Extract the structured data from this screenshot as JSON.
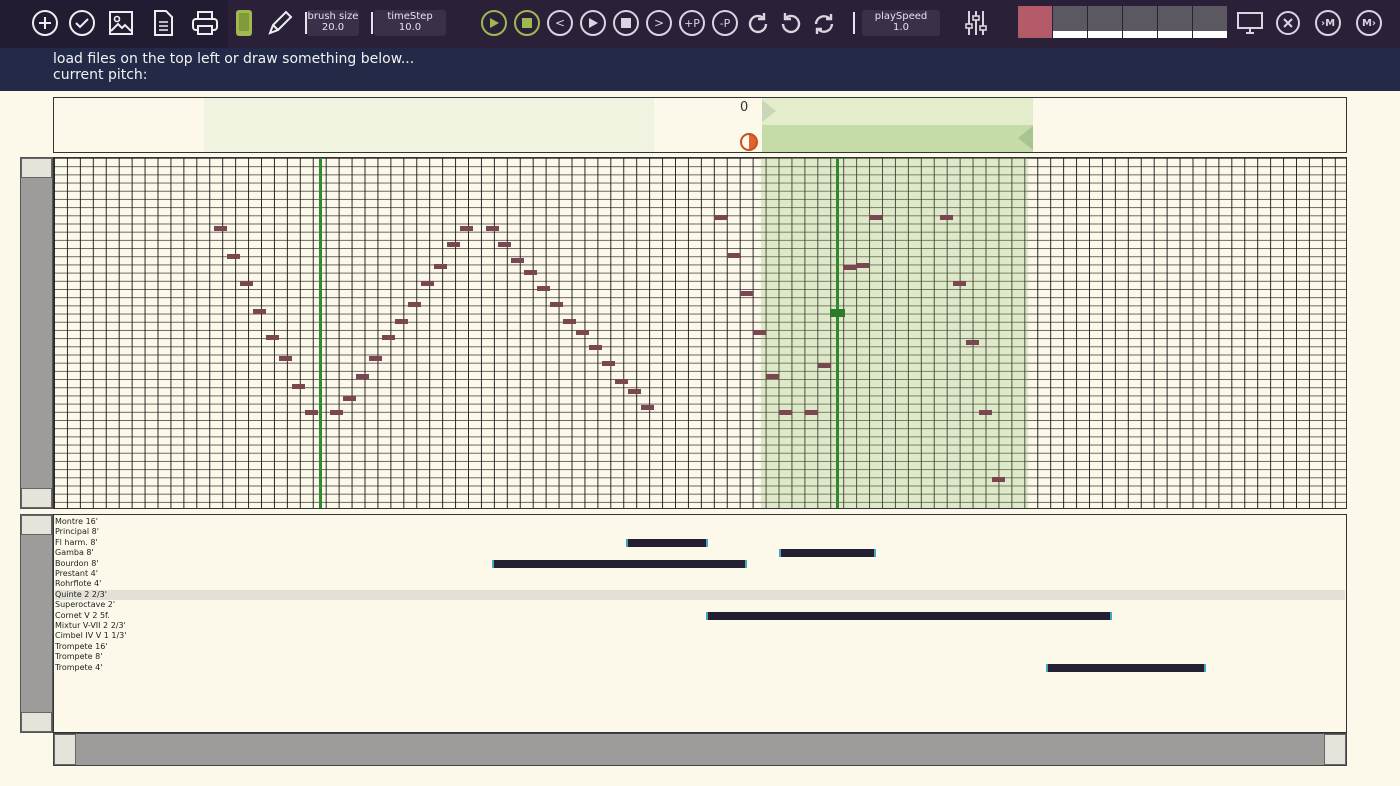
{
  "toolbar": {
    "icons": [
      "add-icon",
      "check-icon",
      "image-icon",
      "document-icon",
      "print-icon",
      "phone-icon",
      "pencil-icon"
    ],
    "brush_size_label": "brush size",
    "brush_size_value": "20.0",
    "time_step_label": "timeStep",
    "time_step_value": "10.0",
    "transport": {
      "prev_label": "<",
      "next_label": ">",
      "add_p_label": "+P",
      "remove_p_label": "-P"
    },
    "play_speed_label": "playSpeed",
    "play_speed_value": "1.0",
    "right_buttons": {
      "m_in_label": "M",
      "m_out_label": "M"
    },
    "colors": {
      "accent_play": "#a0b850",
      "palette_active": "#b45a68",
      "palette": "#5c5862",
      "toolbar_bg": "#2a2139"
    }
  },
  "info": {
    "line1": "load files on the top left or draw something below...",
    "line2": "current pitch:"
  },
  "overview": {
    "counter": "0"
  },
  "piano_roll": {
    "playhead_positions": [
      0.205,
      0.605
    ],
    "selection_range": [
      0.547,
      0.754
    ],
    "notes": [
      {
        "t": 0.124,
        "p": 0.195
      },
      {
        "t": 0.134,
        "p": 0.275
      },
      {
        "t": 0.144,
        "p": 0.352
      },
      {
        "t": 0.154,
        "p": 0.43
      },
      {
        "t": 0.164,
        "p": 0.505
      },
      {
        "t": 0.174,
        "p": 0.565
      },
      {
        "t": 0.184,
        "p": 0.645
      },
      {
        "t": 0.194,
        "p": 0.72
      },
      {
        "t": 0.214,
        "p": 0.72
      },
      {
        "t": 0.224,
        "p": 0.68
      },
      {
        "t": 0.234,
        "p": 0.617
      },
      {
        "t": 0.244,
        "p": 0.565
      },
      {
        "t": 0.254,
        "p": 0.505
      },
      {
        "t": 0.264,
        "p": 0.46
      },
      {
        "t": 0.274,
        "p": 0.41
      },
      {
        "t": 0.284,
        "p": 0.352
      },
      {
        "t": 0.294,
        "p": 0.303
      },
      {
        "t": 0.304,
        "p": 0.24
      },
      {
        "t": 0.314,
        "p": 0.195
      },
      {
        "t": 0.334,
        "p": 0.195
      },
      {
        "t": 0.344,
        "p": 0.24
      },
      {
        "t": 0.354,
        "p": 0.287
      },
      {
        "t": 0.364,
        "p": 0.32
      },
      {
        "t": 0.374,
        "p": 0.365
      },
      {
        "t": 0.384,
        "p": 0.41
      },
      {
        "t": 0.394,
        "p": 0.46
      },
      {
        "t": 0.404,
        "p": 0.49
      },
      {
        "t": 0.414,
        "p": 0.535
      },
      {
        "t": 0.424,
        "p": 0.58
      },
      {
        "t": 0.434,
        "p": 0.63
      },
      {
        "t": 0.444,
        "p": 0.66
      },
      {
        "t": 0.454,
        "p": 0.705
      },
      {
        "t": 0.511,
        "p": 0.163
      },
      {
        "t": 0.521,
        "p": 0.272
      },
      {
        "t": 0.531,
        "p": 0.38
      },
      {
        "t": 0.541,
        "p": 0.49
      },
      {
        "t": 0.551,
        "p": 0.617
      },
      {
        "t": 0.561,
        "p": 0.72
      },
      {
        "t": 0.581,
        "p": 0.72
      },
      {
        "t": 0.591,
        "p": 0.585
      },
      {
        "t": 0.611,
        "p": 0.305
      },
      {
        "t": 0.621,
        "p": 0.3
      },
      {
        "t": 0.631,
        "p": 0.163
      },
      {
        "t": 0.686,
        "p": 0.163
      },
      {
        "t": 0.696,
        "p": 0.35
      },
      {
        "t": 0.706,
        "p": 0.52
      },
      {
        "t": 0.716,
        "p": 0.72
      },
      {
        "t": 0.726,
        "p": 0.91
      }
    ]
  },
  "registers": {
    "labels": [
      "Montre 16'",
      "Principal 8'",
      "Fl harm. 8'",
      "Gamba 8'",
      "Bourdon 8'",
      "Prestant 4'",
      "Rohrflote 4'",
      "Quinte 2 2/3'",
      "Superoctave 2'",
      "Cornet V 2 5f.",
      "Mixtur V-VII 2 2/3'",
      "Cimbel IV V 1 1/3'",
      "Trompete 16'",
      "Trompete 8'",
      "Trompete 4'"
    ],
    "highlighted_index": 7,
    "bars": [
      {
        "row": 2,
        "start": 0.443,
        "end": 0.506
      },
      {
        "row": 3,
        "start": 0.561,
        "end": 0.636
      },
      {
        "row": 4,
        "start": 0.339,
        "end": 0.536
      },
      {
        "row": 9,
        "start": 0.505,
        "end": 0.819
      },
      {
        "row": 14,
        "start": 0.768,
        "end": 0.892
      }
    ]
  }
}
